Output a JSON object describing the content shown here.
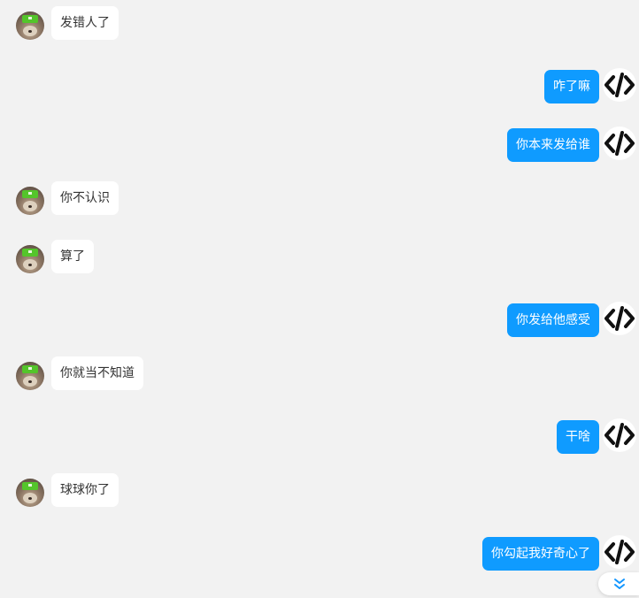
{
  "messages": [
    {
      "side": "left",
      "text": "发错人了"
    },
    {
      "side": "right",
      "text": "咋了嘛"
    },
    {
      "side": "right",
      "text": "你本来发给谁"
    },
    {
      "side": "left",
      "text": "你不认识"
    },
    {
      "side": "left",
      "text": "算了"
    },
    {
      "side": "right",
      "text": "你发给他感受"
    },
    {
      "side": "left",
      "text": "你就当不知道"
    },
    {
      "side": "right",
      "text": "干啥"
    },
    {
      "side": "left",
      "text": "球球你了"
    },
    {
      "side": "right",
      "text": "你勾起我好奇心了"
    }
  ],
  "icons": {
    "user_avatar": "user-avatar",
    "self_avatar": "code-brackets-icon",
    "scroll_down": "double-chevron-down-icon"
  },
  "colors": {
    "background": "#f2f2f2",
    "incoming_bubble": "#ffffff",
    "outgoing_bubble": "#0f9bff",
    "outgoing_text": "#ffffff",
    "incoming_text": "#333333"
  }
}
